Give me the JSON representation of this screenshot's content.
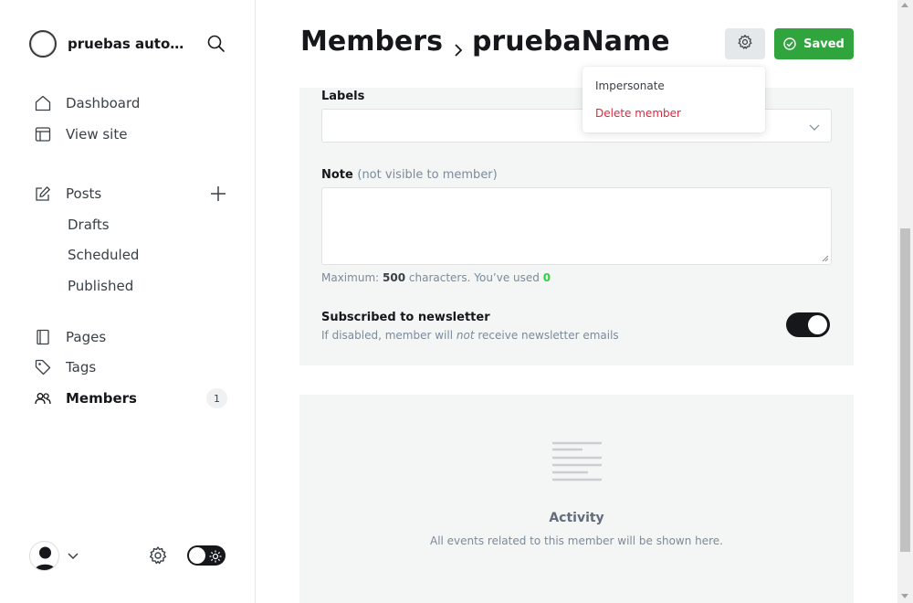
{
  "sidebar": {
    "site_name": "pruebas automa...",
    "nav": {
      "dashboard": "Dashboard",
      "view_site": "View site",
      "posts": "Posts",
      "drafts": "Drafts",
      "scheduled": "Scheduled",
      "published": "Published",
      "pages": "Pages",
      "tags": "Tags",
      "members": "Members",
      "members_count": "1"
    },
    "icons": [
      "search-icon",
      "home-icon",
      "layout-icon",
      "edit-icon",
      "plus-icon",
      "page-icon",
      "tag-icon",
      "members-icon",
      "user-avatar-icon",
      "chevron-down-icon",
      "gear-icon",
      "sun-icon"
    ]
  },
  "header": {
    "section": "Members",
    "member_name": "pruebaName",
    "saved_label": "Saved"
  },
  "dropdown": {
    "impersonate": "Impersonate",
    "delete": "Delete member"
  },
  "form": {
    "labels_label": "Labels",
    "note_label": "Note",
    "note_sublabel": "(not visible to member)",
    "note_hint_prefix": "Maximum:",
    "note_hint_max": "500",
    "note_hint_mid": "characters. You’ve used",
    "note_hint_used": "0",
    "newsletter_title": "Subscribed to newsletter",
    "newsletter_desc_pre": "If disabled, member will",
    "newsletter_desc_em": "not",
    "newsletter_desc_post": "receive newsletter emails",
    "newsletter_enabled": true
  },
  "activity": {
    "title": "Activity",
    "description": "All events related to this member will be shown here."
  },
  "colors": {
    "accent_green": "#30a43d",
    "danger_red": "#e0263c",
    "counter_green": "#30cf43"
  }
}
